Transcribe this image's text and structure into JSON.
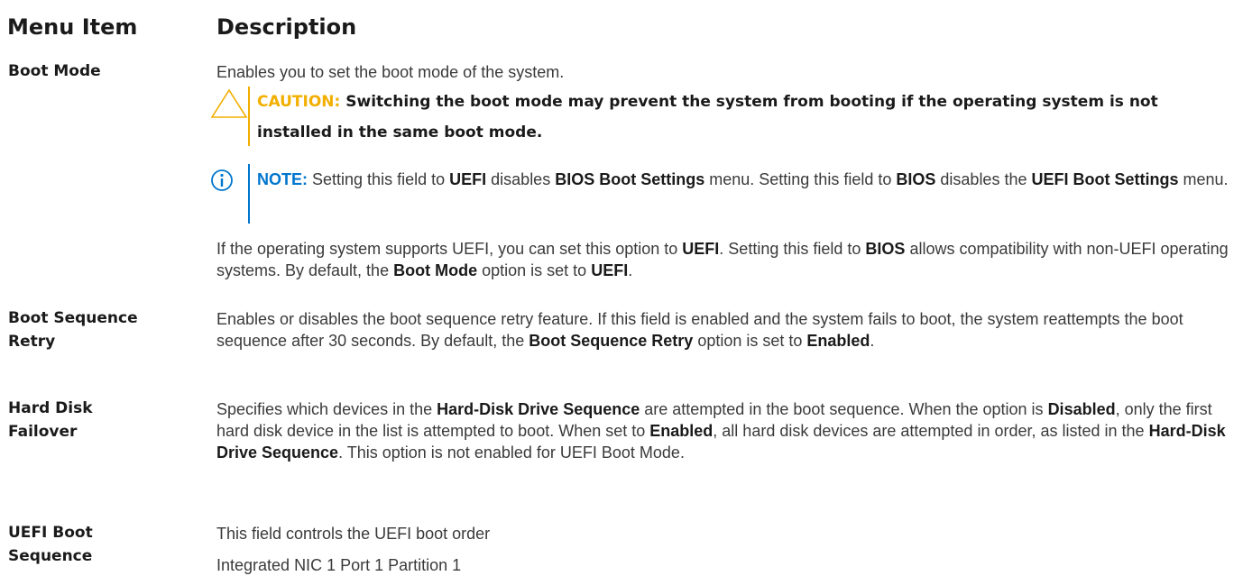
{
  "table": {
    "col_menu_item": "Menu Item",
    "col_description": "Description"
  },
  "boot_mode": {
    "label": "Boot Mode",
    "intro": "Enables you to set the boot mode of the system.",
    "caution_tag": "CAUTION:",
    "caution_text": "Switching the boot mode may prevent the system from booting if the operating system is not installed in the same boot mode.",
    "note_tag": "NOTE:",
    "note_t1": "Setting this field to",
    "note_b1": "UEFI",
    "note_t2": "disables",
    "note_b2": "BIOS Boot Settings",
    "note_t3": "menu. Setting this field to",
    "note_b3": "BIOS",
    "note_t4": "disables the",
    "note_b4": "UEFI Boot Settings",
    "note_t5": "menu.",
    "p_t1": "If the operating system supports UEFI, you can set this option to",
    "p_b1": "UEFI",
    "p_t2": ". Setting this field to",
    "p_b2": "BIOS",
    "p_t3": "allows compatibility with non-UEFI operating systems. By default, the",
    "p_b3": "Boot Mode",
    "p_t4": "option is set to",
    "p_b4": "UEFI",
    "p_t5": "."
  },
  "boot_sequence_retry": {
    "label_1": "Boot Sequence",
    "label_2": "Retry",
    "t1": "Enables or disables the boot sequence retry feature. If this field is enabled and the system fails to boot, the system reattempts the boot sequence after 30 seconds. By default, the",
    "b1": "Boot Sequence Retry",
    "t2": "option is set to",
    "b2": "Enabled",
    "t3": "."
  },
  "hard_disk_failover": {
    "label_1": "Hard Disk",
    "label_2": "Failover",
    "t1": "Specifies which devices in the",
    "b1": "Hard-Disk Drive Sequence",
    "t2": "are attempted in the boot sequence. When the option is",
    "b2": "Disabled",
    "t3": ", only the first hard disk device in the list is attempted to boot. When set to",
    "b3": "Enabled",
    "t4": ", all hard disk devices are attempted in order, as listed in the",
    "b4": "Hard-Disk Drive Sequence",
    "t5": ". This option is not enabled for UEFI Boot Mode."
  },
  "uefi_boot_sequence": {
    "label_1": "UEFI Boot",
    "label_2": "Sequence",
    "line_1": "This field controls the UEFI boot order",
    "line_2": "Integrated NIC 1 Port 1 Partition 1"
  }
}
